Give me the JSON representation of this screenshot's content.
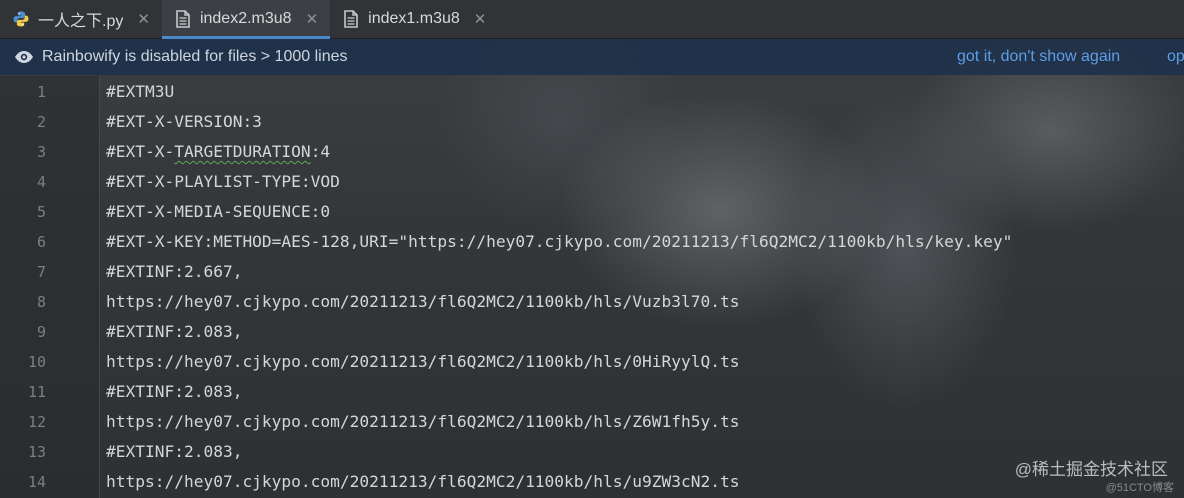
{
  "tabs": [
    {
      "label": "一人之下.py",
      "icon": "python-file-icon",
      "active": false
    },
    {
      "label": "index2.m3u8",
      "icon": "text-file-icon",
      "active": true
    },
    {
      "label": "index1.m3u8",
      "icon": "text-file-icon",
      "active": false
    }
  ],
  "banner": {
    "icon": "eye-icon",
    "message": "Rainbowify is disabled for files > 1000 lines",
    "dismiss_link": "got it, don't show again",
    "options_link": "op"
  },
  "editor": {
    "lines": [
      {
        "number": "1",
        "text": "#EXTM3U"
      },
      {
        "number": "2",
        "text": "#EXT-X-VERSION:3"
      },
      {
        "number": "3",
        "text_before": "#EXT-X-",
        "text_squiggle": "TARGETDURATION",
        "text_after": ":4"
      },
      {
        "number": "4",
        "text": "#EXT-X-PLAYLIST-TYPE:VOD"
      },
      {
        "number": "5",
        "text": "#EXT-X-MEDIA-SEQUENCE:0"
      },
      {
        "number": "6",
        "text": "#EXT-X-KEY:METHOD=AES-128,URI=\"https://hey07.cjkypo.com/20211213/fl6Q2MC2/1100kb/hls/key.key\""
      },
      {
        "number": "7",
        "text": "#EXTINF:2.667,"
      },
      {
        "number": "8",
        "text": "https://hey07.cjkypo.com/20211213/fl6Q2MC2/1100kb/hls/Vuzb3l70.ts"
      },
      {
        "number": "9",
        "text": "#EXTINF:2.083,"
      },
      {
        "number": "10",
        "text": "https://hey07.cjkypo.com/20211213/fl6Q2MC2/1100kb/hls/0HiRyylQ.ts"
      },
      {
        "number": "11",
        "text": "#EXTINF:2.083,"
      },
      {
        "number": "12",
        "text": "https://hey07.cjkypo.com/20211213/fl6Q2MC2/1100kb/hls/Z6W1fh5y.ts"
      },
      {
        "number": "13",
        "text": "#EXTINF:2.083,"
      },
      {
        "number": "14",
        "text": "https://hey07.cjkypo.com/20211213/fl6Q2MC2/1100kb/hls/u9ZW3cN2.ts"
      }
    ]
  },
  "watermark": {
    "main": "@稀土掘金技术社区",
    "small": "@51CTO博客"
  },
  "colors": {
    "accent": "#4a88c7",
    "link": "#5d9ee6",
    "banner_bg": "#1e314a",
    "code_text": "#d4d6d9",
    "line_number": "#7b7e84"
  }
}
